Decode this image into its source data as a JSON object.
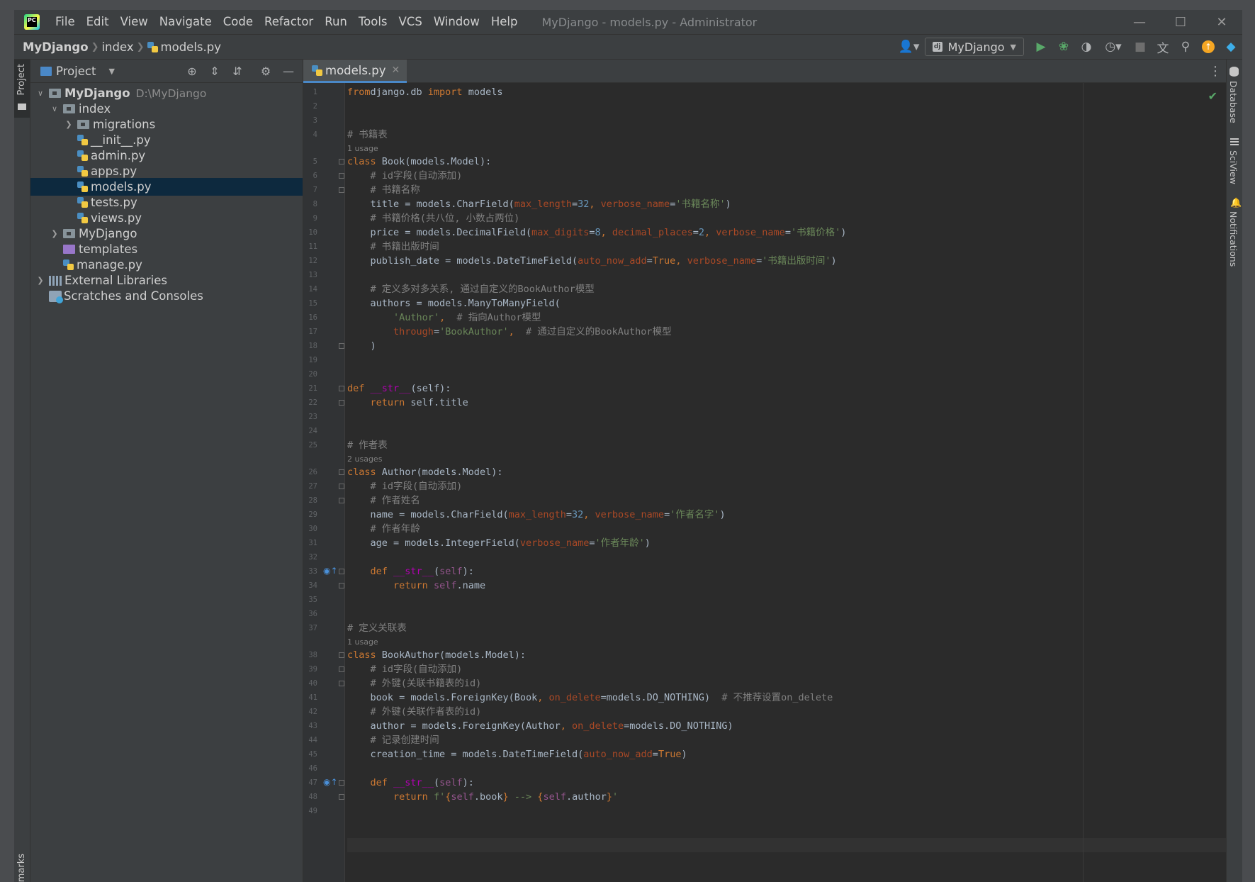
{
  "titlebar": {
    "menu": [
      "File",
      "Edit",
      "View",
      "Navigate",
      "Code",
      "Refactor",
      "Run",
      "Tools",
      "VCS",
      "Window",
      "Help"
    ],
    "window_title": "MyDjango - models.py - Administrator"
  },
  "navbar": {
    "breadcrumb": [
      "MyDjango",
      "index",
      "models.py"
    ],
    "run_config": "MyDjango"
  },
  "left_strip": {
    "project_label": "Project",
    "bookmarks_label": "Bookmarks"
  },
  "right_strip": {
    "database": "Database",
    "sciview": "SciView",
    "notifications": "Notifications"
  },
  "project_panel": {
    "title": "Project",
    "tree": [
      {
        "label": "MyDjango",
        "hint": "D:\\MyDjango",
        "depth": 0,
        "type": "folder-root",
        "expanded": true
      },
      {
        "label": "index",
        "depth": 1,
        "type": "folder",
        "expanded": true
      },
      {
        "label": "migrations",
        "depth": 2,
        "type": "folder",
        "expanded": false
      },
      {
        "label": "__init__.py",
        "depth": 2,
        "type": "py"
      },
      {
        "label": "admin.py",
        "depth": 2,
        "type": "py"
      },
      {
        "label": "apps.py",
        "depth": 2,
        "type": "py"
      },
      {
        "label": "models.py",
        "depth": 2,
        "type": "py",
        "selected": true
      },
      {
        "label": "tests.py",
        "depth": 2,
        "type": "py"
      },
      {
        "label": "views.py",
        "depth": 2,
        "type": "py"
      },
      {
        "label": "MyDjango",
        "depth": 1,
        "type": "folder",
        "expanded": false
      },
      {
        "label": "templates",
        "depth": 1,
        "type": "folder-purple"
      },
      {
        "label": "manage.py",
        "depth": 1,
        "type": "py"
      },
      {
        "label": "External Libraries",
        "depth": 0,
        "type": "lib",
        "expanded": false
      },
      {
        "label": "Scratches and Consoles",
        "depth": 0,
        "type": "scratch"
      }
    ]
  },
  "editor": {
    "tab": "models.py",
    "lines": [
      {
        "n": 1,
        "t": [
          [
            "kw",
            "from"
          ],
          [
            "",
            "django.db "
          ],
          [
            "kw",
            "import"
          ],
          [
            "",
            " models"
          ]
        ]
      },
      {
        "n": 2,
        "t": []
      },
      {
        "n": 3,
        "t": []
      },
      {
        "n": 4,
        "t": [
          [
            "cm",
            "# 书籍表"
          ]
        ]
      },
      {
        "n": 5,
        "inlay": "1 usage",
        "fold": true,
        "t": [
          [
            "kw",
            "class"
          ],
          [
            "",
            " Book(models.Model):"
          ]
        ]
      },
      {
        "n": 6,
        "fold": true,
        "t": [
          [
            "",
            "    "
          ],
          [
            "cm",
            "# id字段(自动添加)"
          ]
        ]
      },
      {
        "n": 7,
        "fold": true,
        "t": [
          [
            "",
            "    "
          ],
          [
            "cm",
            "# 书籍名称"
          ]
        ]
      },
      {
        "n": 8,
        "t": [
          [
            "",
            "    title = models.CharField("
          ],
          [
            "pa",
            "max_length"
          ],
          [
            "",
            "="
          ],
          [
            "nu",
            "32"
          ],
          [
            "kw",
            ", "
          ],
          [
            "pa",
            "verbose_name"
          ],
          [
            "",
            "="
          ],
          [
            "st",
            "'书籍名称'"
          ],
          [
            "",
            ")"
          ]
        ]
      },
      {
        "n": 9,
        "t": [
          [
            "",
            "    "
          ],
          [
            "cm",
            "# 书籍价格(共八位, 小数占两位)"
          ]
        ]
      },
      {
        "n": 10,
        "t": [
          [
            "",
            "    price = models.DecimalField("
          ],
          [
            "pa",
            "max_digits"
          ],
          [
            "",
            "="
          ],
          [
            "nu",
            "8"
          ],
          [
            "kw",
            ", "
          ],
          [
            "pa",
            "decimal_places"
          ],
          [
            "",
            "="
          ],
          [
            "nu",
            "2"
          ],
          [
            "kw",
            ", "
          ],
          [
            "pa",
            "verbose_name"
          ],
          [
            "",
            "="
          ],
          [
            "st",
            "'书籍价格'"
          ],
          [
            "",
            ")"
          ]
        ]
      },
      {
        "n": 11,
        "t": [
          [
            "",
            "    "
          ],
          [
            "cm",
            "# 书籍出版时间"
          ]
        ]
      },
      {
        "n": 12,
        "t": [
          [
            "",
            "    publish_date = models.DateTimeField("
          ],
          [
            "pa",
            "auto_now_add"
          ],
          [
            "",
            "="
          ],
          [
            "kw",
            "True"
          ],
          [
            "kw",
            ", "
          ],
          [
            "pa",
            "verbose_name"
          ],
          [
            "",
            "="
          ],
          [
            "st",
            "'书籍出版时间'"
          ],
          [
            "",
            ")"
          ]
        ]
      },
      {
        "n": 13,
        "t": []
      },
      {
        "n": 14,
        "t": [
          [
            "",
            "    "
          ],
          [
            "cm",
            "# 定义多对多关系, 通过自定义的BookAuthor模型"
          ]
        ]
      },
      {
        "n": 15,
        "t": [
          [
            "",
            "    authors = models.ManyToManyField("
          ]
        ]
      },
      {
        "n": 16,
        "t": [
          [
            "",
            "        "
          ],
          [
            "st",
            "'Author'"
          ],
          [
            "kw",
            ","
          ],
          [
            "",
            "  "
          ],
          [
            "cm",
            "# 指向Author模型"
          ]
        ]
      },
      {
        "n": 17,
        "t": [
          [
            "",
            "        "
          ],
          [
            "pa",
            "through"
          ],
          [
            "",
            "="
          ],
          [
            "st",
            "'BookAuthor'"
          ],
          [
            "kw",
            ","
          ],
          [
            "",
            "  "
          ],
          [
            "cm",
            "# 通过自定义的BookAuthor模型"
          ]
        ]
      },
      {
        "n": 18,
        "fold": true,
        "t": [
          [
            "",
            "    )"
          ]
        ]
      },
      {
        "n": 19,
        "t": []
      },
      {
        "n": 20,
        "t": []
      },
      {
        "n": 21,
        "fold": true,
        "t": [
          [
            "kw",
            "def"
          ],
          [
            "",
            " "
          ],
          [
            "dunder",
            "__str__"
          ],
          [
            "",
            "(self):"
          ]
        ]
      },
      {
        "n": 22,
        "fold": true,
        "t": [
          [
            "",
            "    "
          ],
          [
            "kw",
            "return"
          ],
          [
            "",
            " self.title"
          ]
        ]
      },
      {
        "n": 23,
        "t": []
      },
      {
        "n": 24,
        "t": []
      },
      {
        "n": 25,
        "t": [
          [
            "cm",
            "# 作者表"
          ]
        ]
      },
      {
        "n": 26,
        "inlay": "2 usages",
        "fold": true,
        "t": [
          [
            "kw",
            "class"
          ],
          [
            "",
            " Author(models.Model):"
          ]
        ]
      },
      {
        "n": 27,
        "fold": true,
        "t": [
          [
            "",
            "    "
          ],
          [
            "cm",
            "# id字段(自动添加)"
          ]
        ]
      },
      {
        "n": 28,
        "fold": true,
        "t": [
          [
            "",
            "    "
          ],
          [
            "cm",
            "# 作者姓名"
          ]
        ]
      },
      {
        "n": 29,
        "t": [
          [
            "",
            "    name = models.CharField("
          ],
          [
            "pa",
            "max_length"
          ],
          [
            "",
            "="
          ],
          [
            "nu",
            "32"
          ],
          [
            "kw",
            ", "
          ],
          [
            "pa",
            "verbose_name"
          ],
          [
            "",
            "="
          ],
          [
            "st",
            "'作者名字'"
          ],
          [
            "",
            ")"
          ]
        ]
      },
      {
        "n": 30,
        "t": [
          [
            "",
            "    "
          ],
          [
            "cm",
            "# 作者年龄"
          ]
        ]
      },
      {
        "n": 31,
        "t": [
          [
            "",
            "    age = models.IntegerField("
          ],
          [
            "pa",
            "verbose_name"
          ],
          [
            "",
            "="
          ],
          [
            "st",
            "'作者年龄'"
          ],
          [
            "",
            ")"
          ]
        ]
      },
      {
        "n": 32,
        "t": []
      },
      {
        "n": 33,
        "override": true,
        "fold": true,
        "t": [
          [
            "",
            "    "
          ],
          [
            "kw",
            "def"
          ],
          [
            "",
            " "
          ],
          [
            "dunder",
            "__str__"
          ],
          [
            "",
            "("
          ],
          [
            "se",
            "self"
          ],
          [
            "",
            "):"
          ]
        ]
      },
      {
        "n": 34,
        "fold": true,
        "t": [
          [
            "",
            "        "
          ],
          [
            "kw",
            "return"
          ],
          [
            "",
            " "
          ],
          [
            "se",
            "self"
          ],
          [
            "",
            ".name"
          ]
        ]
      },
      {
        "n": 35,
        "t": []
      },
      {
        "n": 36,
        "t": []
      },
      {
        "n": 37,
        "t": [
          [
            "cm",
            "# 定义关联表"
          ]
        ]
      },
      {
        "n": 38,
        "inlay": "1 usage",
        "fold": true,
        "t": [
          [
            "kw",
            "class"
          ],
          [
            "",
            " BookAuthor(models.Model):"
          ]
        ]
      },
      {
        "n": 39,
        "fold": true,
        "t": [
          [
            "",
            "    "
          ],
          [
            "cm",
            "# id字段(自动添加)"
          ]
        ]
      },
      {
        "n": 40,
        "fold": true,
        "t": [
          [
            "",
            "    "
          ],
          [
            "cm",
            "# 外键(关联书籍表的id)"
          ]
        ]
      },
      {
        "n": 41,
        "t": [
          [
            "",
            "    book = models.ForeignKey(Book"
          ],
          [
            "kw",
            ", "
          ],
          [
            "pa",
            "on_delete"
          ],
          [
            "",
            "=models.DO_NOTHING)  "
          ],
          [
            "cm",
            "# 不推荐设置on_delete"
          ]
        ]
      },
      {
        "n": 42,
        "t": [
          [
            "",
            "    "
          ],
          [
            "cm",
            "# 外键(关联作者表的id)"
          ]
        ]
      },
      {
        "n": 43,
        "t": [
          [
            "",
            "    author = models.ForeignKey(Author"
          ],
          [
            "kw",
            ", "
          ],
          [
            "pa",
            "on_delete"
          ],
          [
            "",
            "=models.DO_NOTHING)"
          ]
        ]
      },
      {
        "n": 44,
        "t": [
          [
            "",
            "    "
          ],
          [
            "cm",
            "# 记录创建时间"
          ]
        ]
      },
      {
        "n": 45,
        "t": [
          [
            "",
            "    creation_time = models.DateTimeField("
          ],
          [
            "pa",
            "auto_now_add"
          ],
          [
            "",
            "="
          ],
          [
            "kw",
            "True"
          ],
          [
            "",
            ")"
          ]
        ]
      },
      {
        "n": 46,
        "t": []
      },
      {
        "n": 47,
        "override": true,
        "fold": true,
        "t": [
          [
            "",
            "    "
          ],
          [
            "kw",
            "def"
          ],
          [
            "",
            " "
          ],
          [
            "dunder",
            "__str__"
          ],
          [
            "",
            "("
          ],
          [
            "se",
            "self"
          ],
          [
            "",
            "):"
          ]
        ]
      },
      {
        "n": 48,
        "fold": true,
        "t": [
          [
            "",
            "        "
          ],
          [
            "kw",
            "return"
          ],
          [
            "",
            " "
          ],
          [
            "st",
            "f'"
          ],
          [
            "kw",
            "{"
          ],
          [
            "se",
            "self"
          ],
          [
            "",
            ".book"
          ],
          [
            "kw",
            "}"
          ],
          [
            "st",
            " --> "
          ],
          [
            "kw",
            "{"
          ],
          [
            "se",
            "self"
          ],
          [
            "",
            ".author"
          ],
          [
            "kw",
            "}"
          ],
          [
            "st",
            "'"
          ]
        ]
      },
      {
        "n": 49,
        "t": []
      }
    ]
  },
  "colors": {
    "accent": "#4a88c7",
    "selection": "#0d293e",
    "keyword": "#cc7832",
    "string": "#6a8759",
    "number": "#6897bb",
    "comment": "#808080",
    "param": "#aa4926",
    "dunder": "#b200b2"
  }
}
